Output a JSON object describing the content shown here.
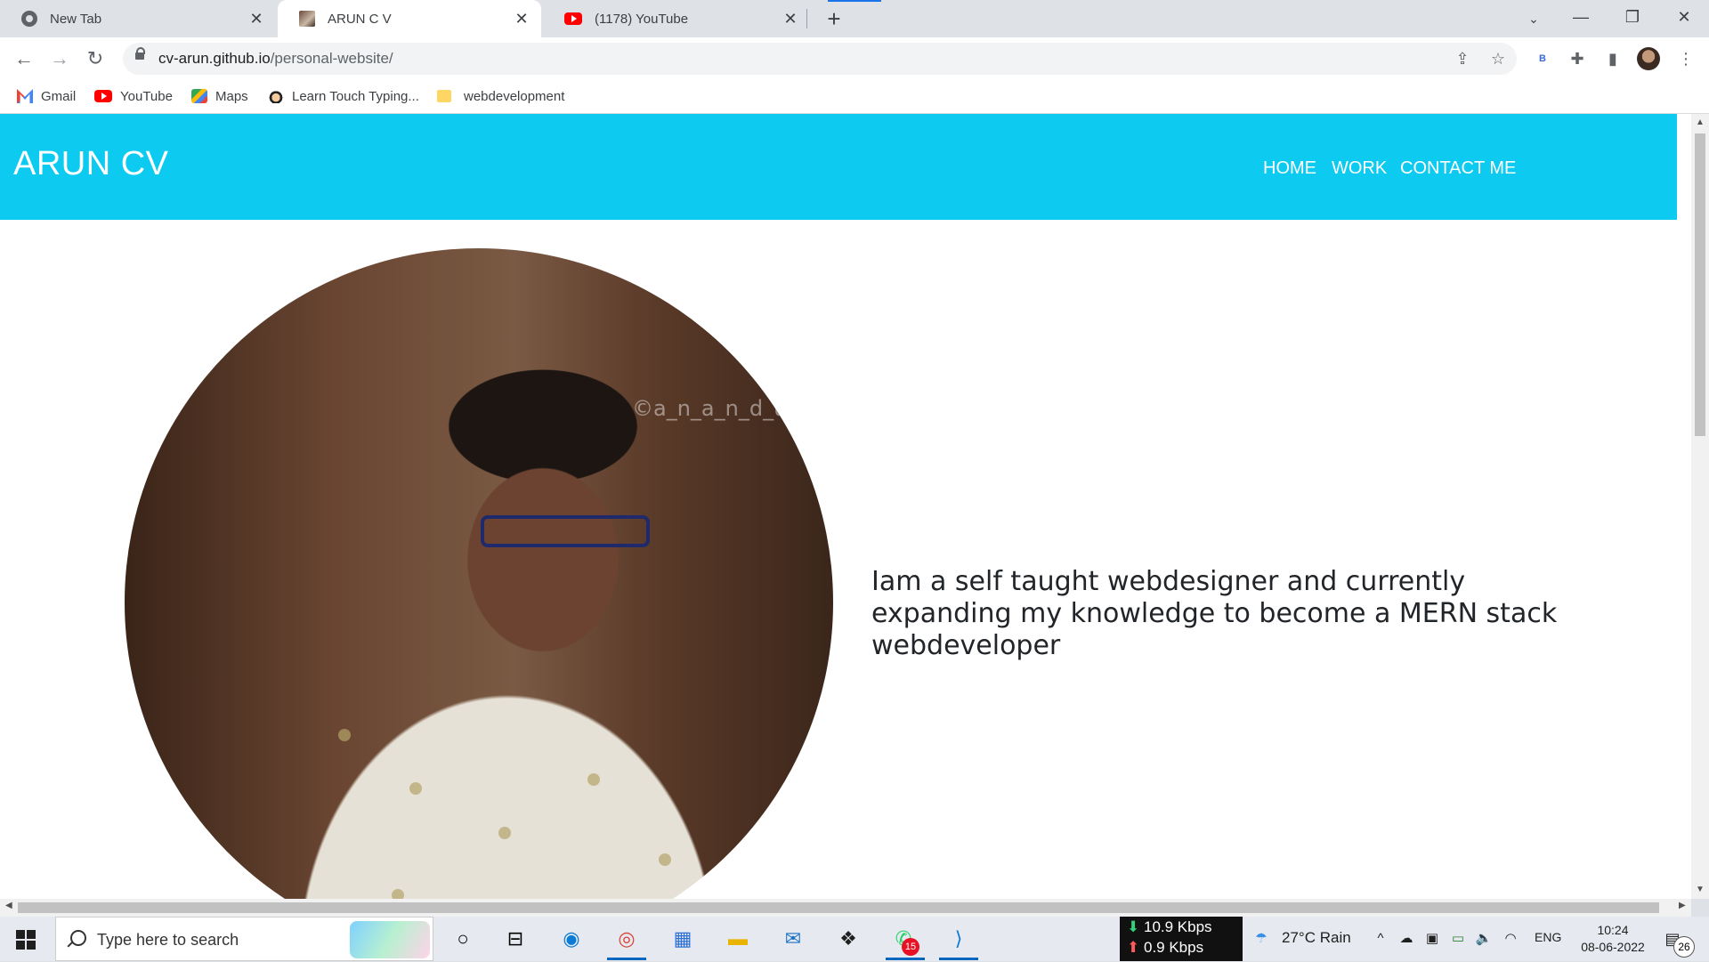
{
  "browser": {
    "tabs": [
      {
        "title": "New Tab",
        "favicon": "chrome-icon",
        "active": false
      },
      {
        "title": "ARUN C V",
        "favicon": "profile-photo-icon",
        "active": true
      },
      {
        "title": "(1178) YouTube",
        "favicon": "youtube-icon",
        "active": false
      }
    ],
    "new_tab_symbol": "+",
    "close_symbol": "✕",
    "window_controls": {
      "minimize": "—",
      "restore": "❐",
      "close": "✕"
    },
    "url_host": "cv-arun.github.io",
    "url_path": "/personal-website/",
    "extension_letter": "B",
    "bookmarks": [
      {
        "label": "Gmail",
        "icon": "gmail-icon"
      },
      {
        "label": "YouTube",
        "icon": "youtube-icon"
      },
      {
        "label": "Maps",
        "icon": "maps-icon"
      },
      {
        "label": "Learn Touch Typing...",
        "icon": "typing-icon"
      },
      {
        "label": "webdevelopment",
        "icon": "folder-icon"
      }
    ]
  },
  "site": {
    "logo": "ARUN CV",
    "nav": [
      "HOME",
      "WORK",
      "CONTACT ME"
    ],
    "watermark": "©a_n_a_n_d_u_s",
    "intro": "Iam a self taught webdesigner and currently expanding my knowledge to become a MERN stack webdeveloper",
    "header_color": "#0dcaf0"
  },
  "taskbar": {
    "search_placeholder": "Type here to search",
    "net_down": "10.9 Kbps",
    "net_up": "0.9 Kbps",
    "weather": "27°C  Rain",
    "language": "ENG",
    "time": "10:24",
    "date": "08-06-2022",
    "whatsapp_badge": "15",
    "notification_count": "26"
  }
}
